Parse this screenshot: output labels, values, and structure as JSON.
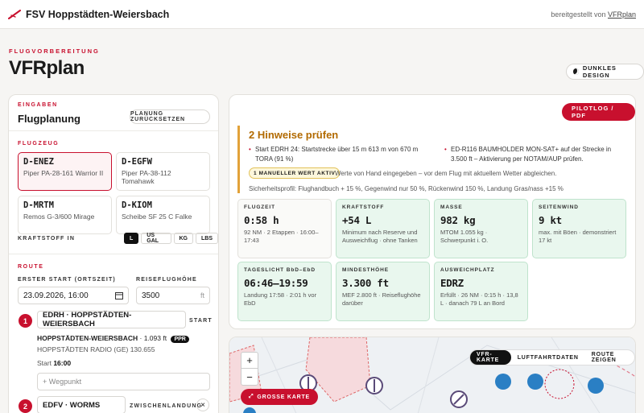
{
  "header": {
    "club_name": "FSV Hoppstädten-Weiersbach",
    "credit_prefix": "bereitgestellt von",
    "credit_link": "VFRplan"
  },
  "page": {
    "kicker": "FLUGVORBEREITUNG",
    "title": "VFRplan",
    "dark_mode_label": "DUNKLES DESIGN"
  },
  "inputs_panel": {
    "eyebrow": "EINGABEN",
    "title": "Flugplanung",
    "reset_label": "PLANUNG ZURÜCKSETZEN",
    "aircraft_label": "FLUGZEUG",
    "aircraft": [
      {
        "reg": "D-ENEZ",
        "type": "Piper PA-28-161 Warrior II",
        "selected": true
      },
      {
        "reg": "D-EGFW",
        "type": "Piper PA-38-112 Tomahawk",
        "selected": false
      },
      {
        "reg": "D-MRTM",
        "type": "Remos G-3/600 Mirage",
        "selected": false
      },
      {
        "reg": "D-KIOM",
        "type": "Scheibe SF 25 C Falke",
        "selected": false
      }
    ],
    "fuel_unit_label": "KRAFTSTOFF IN",
    "fuel_units": [
      "L",
      "US GAL",
      "KG",
      "LBS"
    ],
    "fuel_unit_selected": "L",
    "route_label": "ROUTE",
    "start_label": "ERSTER START (ORTSZEIT)",
    "start_value": "23.09.2026, 16:00",
    "cruise_label": "REISEFLUGHÖHE",
    "cruise_value": "3500",
    "cruise_unit": "ft",
    "waypoints": [
      {
        "num": "1",
        "value": "EDRH · HOPPSTÄDTEN-WEIERSBACH",
        "role": "START",
        "name": "HOPPSTÄDTEN-WEIERSBACH",
        "elev": "· 1.093 ft",
        "badge": "PPR",
        "radio": "HOPPSTÄDTEN RADIO (GE) 130.655",
        "start_prefix": "Start",
        "start_time": "16:00"
      },
      {
        "num": "2",
        "value": "EDFV · WORMS",
        "role": "ZWISCHENLANDUNG",
        "remove": "×"
      }
    ],
    "add_waypoint_placeholder": "+ Wegpunkt"
  },
  "summary_panel": {
    "pilotlog_label": "PILOTLOG / PDF",
    "warning_title": "2 Hinweise prüfen",
    "warnings": [
      "Start EDRH 24: Startstrecke über 15 m 613 m von 670 m TORA (91 %)",
      "ED-R116 BAUMHOLDER MON-SAT+ auf der Strecke in 3.500 ft – Aktivierung per NOTAM/AUP prüfen."
    ],
    "manual_badge": "1 MANUELLER WERT AKTIV",
    "manual_text": "Werte von Hand eingegeben – vor dem Flug mit aktuellem Wetter abgleichen.",
    "safety_text": "Sicherheitsprofil: Flughandbuch + 15 %, Gegenwind nur 50 %, Rückenwind 150 %, Landung Gras/nass +15 %",
    "cards": [
      {
        "key": "FLUGZEIT",
        "value": "0:58 h",
        "detail": "92 NM · 2 Etappen · 16:00–17:43",
        "ok": false
      },
      {
        "key": "KRAFTSTOFF",
        "value": "+54 L",
        "detail": "Minimum nach Reserve und Ausweichflug · ohne Tanken",
        "ok": true
      },
      {
        "key": "MASSE",
        "value": "982 kg",
        "detail": "MTOM 1.055 kg · Schwerpunkt i. O.",
        "ok": true
      },
      {
        "key": "SEITENWIND",
        "value": "9 kt",
        "detail": "max. mit Böen · demonstriert 17 kt",
        "ok": true
      },
      {
        "key": "TAGESLICHT BbD–EbD",
        "value": "06:46–19:59",
        "detail": "Landung 17:58 · 2:01 h vor EbD",
        "ok": true
      },
      {
        "key": "MINDESTHÖHE",
        "value": "3.300 ft",
        "detail": "MEF 2.800 ft · Reiseflughöhe darüber",
        "ok": true
      },
      {
        "key": "AUSWEICHPLATZ",
        "value": "EDRZ",
        "detail": "Erfüllt · 26 NM · 0:15 h · 13,8 L · danach 79 L an Bord",
        "ok": true
      }
    ]
  },
  "map": {
    "tabs": [
      "VFR-KARTE",
      "LUFTFAHRTDATEN",
      "ROUTE ZEIGEN"
    ],
    "active_tab": "VFR-KARTE",
    "zoom_in": "+",
    "zoom_out": "−",
    "big_map_label": "GROSSE KARTE"
  },
  "colors": {
    "accent": "#c8102e",
    "warning": "#b26a00",
    "ok_bg": "#e9f7ee"
  }
}
